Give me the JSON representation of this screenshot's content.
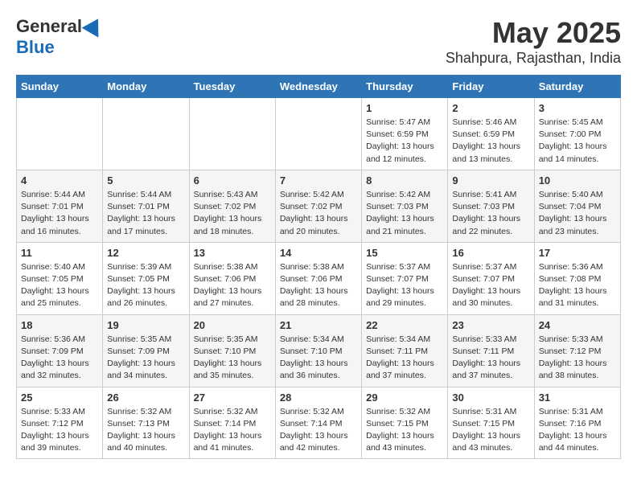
{
  "header": {
    "logo_general": "General",
    "logo_blue": "Blue",
    "month": "May 2025",
    "location": "Shahpura, Rajasthan, India"
  },
  "weekdays": [
    "Sunday",
    "Monday",
    "Tuesday",
    "Wednesday",
    "Thursday",
    "Friday",
    "Saturday"
  ],
  "weeks": [
    [
      {
        "day": "",
        "info": ""
      },
      {
        "day": "",
        "info": ""
      },
      {
        "day": "",
        "info": ""
      },
      {
        "day": "",
        "info": ""
      },
      {
        "day": "1",
        "info": "Sunrise: 5:47 AM\nSunset: 6:59 PM\nDaylight: 13 hours\nand 12 minutes."
      },
      {
        "day": "2",
        "info": "Sunrise: 5:46 AM\nSunset: 6:59 PM\nDaylight: 13 hours\nand 13 minutes."
      },
      {
        "day": "3",
        "info": "Sunrise: 5:45 AM\nSunset: 7:00 PM\nDaylight: 13 hours\nand 14 minutes."
      }
    ],
    [
      {
        "day": "4",
        "info": "Sunrise: 5:44 AM\nSunset: 7:01 PM\nDaylight: 13 hours\nand 16 minutes."
      },
      {
        "day": "5",
        "info": "Sunrise: 5:44 AM\nSunset: 7:01 PM\nDaylight: 13 hours\nand 17 minutes."
      },
      {
        "day": "6",
        "info": "Sunrise: 5:43 AM\nSunset: 7:02 PM\nDaylight: 13 hours\nand 18 minutes."
      },
      {
        "day": "7",
        "info": "Sunrise: 5:42 AM\nSunset: 7:02 PM\nDaylight: 13 hours\nand 20 minutes."
      },
      {
        "day": "8",
        "info": "Sunrise: 5:42 AM\nSunset: 7:03 PM\nDaylight: 13 hours\nand 21 minutes."
      },
      {
        "day": "9",
        "info": "Sunrise: 5:41 AM\nSunset: 7:03 PM\nDaylight: 13 hours\nand 22 minutes."
      },
      {
        "day": "10",
        "info": "Sunrise: 5:40 AM\nSunset: 7:04 PM\nDaylight: 13 hours\nand 23 minutes."
      }
    ],
    [
      {
        "day": "11",
        "info": "Sunrise: 5:40 AM\nSunset: 7:05 PM\nDaylight: 13 hours\nand 25 minutes."
      },
      {
        "day": "12",
        "info": "Sunrise: 5:39 AM\nSunset: 7:05 PM\nDaylight: 13 hours\nand 26 minutes."
      },
      {
        "day": "13",
        "info": "Sunrise: 5:38 AM\nSunset: 7:06 PM\nDaylight: 13 hours\nand 27 minutes."
      },
      {
        "day": "14",
        "info": "Sunrise: 5:38 AM\nSunset: 7:06 PM\nDaylight: 13 hours\nand 28 minutes."
      },
      {
        "day": "15",
        "info": "Sunrise: 5:37 AM\nSunset: 7:07 PM\nDaylight: 13 hours\nand 29 minutes."
      },
      {
        "day": "16",
        "info": "Sunrise: 5:37 AM\nSunset: 7:07 PM\nDaylight: 13 hours\nand 30 minutes."
      },
      {
        "day": "17",
        "info": "Sunrise: 5:36 AM\nSunset: 7:08 PM\nDaylight: 13 hours\nand 31 minutes."
      }
    ],
    [
      {
        "day": "18",
        "info": "Sunrise: 5:36 AM\nSunset: 7:09 PM\nDaylight: 13 hours\nand 32 minutes."
      },
      {
        "day": "19",
        "info": "Sunrise: 5:35 AM\nSunset: 7:09 PM\nDaylight: 13 hours\nand 34 minutes."
      },
      {
        "day": "20",
        "info": "Sunrise: 5:35 AM\nSunset: 7:10 PM\nDaylight: 13 hours\nand 35 minutes."
      },
      {
        "day": "21",
        "info": "Sunrise: 5:34 AM\nSunset: 7:10 PM\nDaylight: 13 hours\nand 36 minutes."
      },
      {
        "day": "22",
        "info": "Sunrise: 5:34 AM\nSunset: 7:11 PM\nDaylight: 13 hours\nand 37 minutes."
      },
      {
        "day": "23",
        "info": "Sunrise: 5:33 AM\nSunset: 7:11 PM\nDaylight: 13 hours\nand 37 minutes."
      },
      {
        "day": "24",
        "info": "Sunrise: 5:33 AM\nSunset: 7:12 PM\nDaylight: 13 hours\nand 38 minutes."
      }
    ],
    [
      {
        "day": "25",
        "info": "Sunrise: 5:33 AM\nSunset: 7:12 PM\nDaylight: 13 hours\nand 39 minutes."
      },
      {
        "day": "26",
        "info": "Sunrise: 5:32 AM\nSunset: 7:13 PM\nDaylight: 13 hours\nand 40 minutes."
      },
      {
        "day": "27",
        "info": "Sunrise: 5:32 AM\nSunset: 7:14 PM\nDaylight: 13 hours\nand 41 minutes."
      },
      {
        "day": "28",
        "info": "Sunrise: 5:32 AM\nSunset: 7:14 PM\nDaylight: 13 hours\nand 42 minutes."
      },
      {
        "day": "29",
        "info": "Sunrise: 5:32 AM\nSunset: 7:15 PM\nDaylight: 13 hours\nand 43 minutes."
      },
      {
        "day": "30",
        "info": "Sunrise: 5:31 AM\nSunset: 7:15 PM\nDaylight: 13 hours\nand 43 minutes."
      },
      {
        "day": "31",
        "info": "Sunrise: 5:31 AM\nSunset: 7:16 PM\nDaylight: 13 hours\nand 44 minutes."
      }
    ]
  ]
}
